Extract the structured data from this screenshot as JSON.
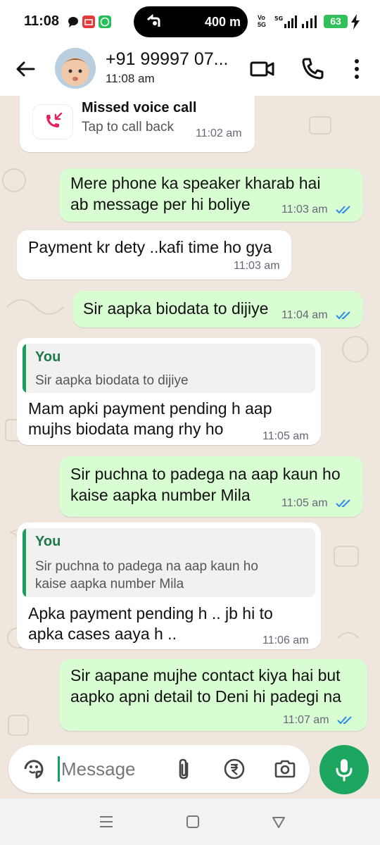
{
  "status_bar": {
    "time": "11:08",
    "pill_text": "400 m",
    "network_label_top": "Vo",
    "network_label_mid": "5G",
    "network_type": "5G",
    "battery": "63"
  },
  "header": {
    "contact_name": "+91 99997 07...",
    "status": "11:08 am"
  },
  "missed_call": {
    "title": "Missed voice call",
    "subtitle": "Tap to call back",
    "time": "11:02 am"
  },
  "messages": [
    {
      "direction": "out",
      "lines": [
        "Mere phone ka speaker kharab hai",
        "ab message per hi boliye"
      ],
      "time": "11:03 am",
      "read": true
    },
    {
      "direction": "in",
      "lines": [
        "Payment kr dety ..kafi time ho gya"
      ],
      "time": "11:03 am"
    },
    {
      "direction": "out",
      "lines": [
        "Sir aapka biodata to dijiye"
      ],
      "time": "11:04 am",
      "read": true
    },
    {
      "direction": "in",
      "quote_author": "You",
      "quote_lines": [
        "Sir aapka biodata to dijiye"
      ],
      "lines": [
        "Mam apki payment pending h aap",
        "mujhs biodata mang rhy ho"
      ],
      "time": "11:05 am"
    },
    {
      "direction": "out",
      "lines": [
        "Sir puchna to padega na aap kaun ho",
        "kaise aapka number Mila"
      ],
      "time": "11:05 am",
      "read": true
    },
    {
      "direction": "in",
      "quote_author": "You",
      "quote_lines": [
        "Sir puchna to padega na aap kaun ho",
        "kaise aapka number Mila"
      ],
      "lines": [
        "Apka payment pending h .. jb hi to",
        "apka cases aaya h .."
      ],
      "time": "11:06 am"
    },
    {
      "direction": "out",
      "lines": [
        "Sir aapane mujhe contact kiya hai but",
        "aapko apni detail to Deni hi padegi na"
      ],
      "time": "11:07 am",
      "read": true
    }
  ],
  "composer": {
    "placeholder": "Message"
  },
  "colors": {
    "outgoing_bubble": "#d9fdd3",
    "incoming_bubble": "#ffffff",
    "accent_green": "#1da660",
    "read_ticks": "#2b8ce6",
    "missed_call_red": "#e0245e"
  }
}
